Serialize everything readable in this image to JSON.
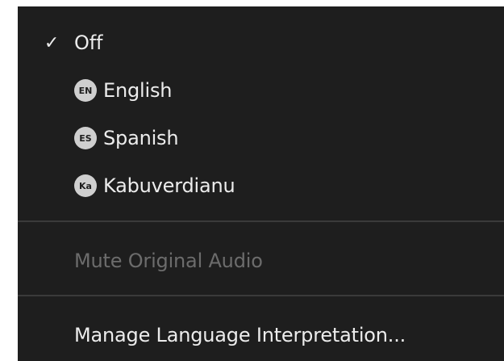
{
  "menu": {
    "off": {
      "label": "Off",
      "checked": true,
      "check_glyph": "✓"
    },
    "languages": [
      {
        "code": "EN",
        "label": "English"
      },
      {
        "code": "ES",
        "label": "Spanish"
      },
      {
        "code": "Ka",
        "label": "Kabuverdianu"
      }
    ],
    "mute_original_audio": {
      "label": "Mute Original Audio",
      "enabled": false
    },
    "manage": {
      "label": "Manage Language Interpretation..."
    }
  },
  "colors": {
    "background": "#1e1e1e",
    "text": "#ececec",
    "disabled_text": "#6c6c6c",
    "divider": "#3a3a3a",
    "badge": "#cfcfcf"
  }
}
